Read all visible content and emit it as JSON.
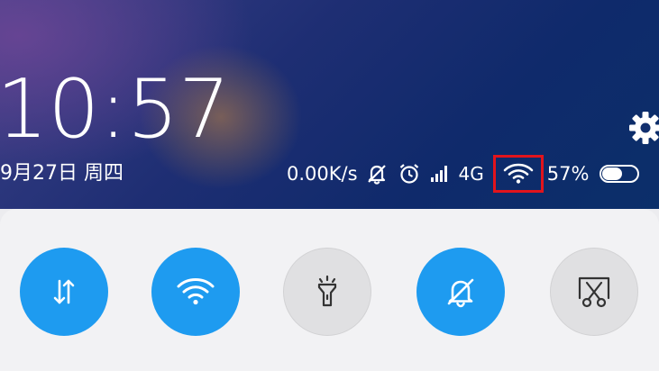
{
  "lockscreen": {
    "time": "10:57",
    "date": "9月27日 周四"
  },
  "status_bar": {
    "net_speed": "0.00K/s",
    "network_type": "4G",
    "battery_percent": "57%",
    "battery_level": 0.57,
    "icons": [
      "mute-bell-off-icon",
      "alarm-clock-icon",
      "cellular-signal-icon",
      "wifi-icon",
      "battery-icon"
    ],
    "highlight_color": "#e2141c"
  },
  "quick_tiles": [
    {
      "id": "mobile-data",
      "icon": "data-transfer-arrows-icon",
      "active": true
    },
    {
      "id": "wifi",
      "icon": "wifi-icon",
      "active": true
    },
    {
      "id": "flashlight",
      "icon": "flashlight-icon",
      "active": false
    },
    {
      "id": "silent",
      "icon": "bell-off-icon",
      "active": true
    },
    {
      "id": "screenshot",
      "icon": "screenshot-scissors-icon",
      "active": false
    }
  ],
  "colors": {
    "tile_active": "#1e9bf0",
    "tile_inactive": "#e0e0e2",
    "panel_bg": "#f2f2f4"
  }
}
